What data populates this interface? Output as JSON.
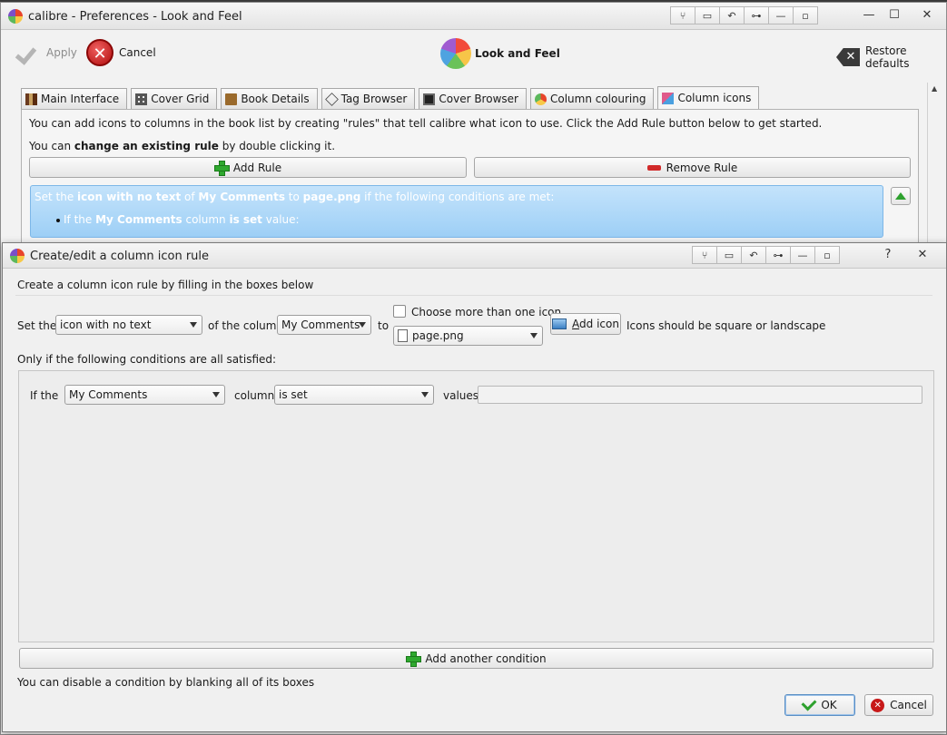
{
  "main_window": {
    "title": "calibre - Preferences - Look and Feel",
    "titlebar_buttons": [
      "⑂",
      "▭",
      "↶",
      "⊶",
      "—",
      "▫"
    ],
    "window_buttons": [
      "—",
      "☐",
      "✕"
    ],
    "toolbar": {
      "apply_label": "Apply",
      "cancel_label": "Cancel",
      "section_title": "Look and Feel",
      "restore_label": "Restore defaults"
    },
    "tabs": [
      {
        "label": "Main Interface",
        "icon": "books-icon"
      },
      {
        "label": "Cover Grid",
        "icon": "grid-icon"
      },
      {
        "label": "Book Details",
        "icon": "book-icon"
      },
      {
        "label": "Tag Browser",
        "icon": "tag-icon"
      },
      {
        "label": "Cover Browser",
        "icon": "cover-icon"
      },
      {
        "label": "Column colouring",
        "icon": "palette-icon"
      },
      {
        "label": "Column icons",
        "icon": "column-icons-icon"
      }
    ],
    "panel": {
      "intro": "You can add icons to columns in the book list by creating \"rules\" that tell calibre what icon to use. Click the Add Rule button below to get started.",
      "change_prefix": "You can ",
      "change_bold": "change an existing rule",
      "change_suffix": " by double clicking it.",
      "add_rule": "Add Rule",
      "remove_rule": "Remove Rule",
      "rule": {
        "line1": [
          "Set the ",
          "icon with no text",
          " of ",
          "My Comments",
          " to ",
          "page.png",
          " if the following conditions are met:"
        ],
        "line2": [
          "If the ",
          "My Comments",
          " column ",
          "is set",
          " value:"
        ]
      }
    }
  },
  "dialog": {
    "title": "Create/edit a column icon rule",
    "titlebar_buttons": [
      "⑂",
      "▭",
      "↶",
      "⊶",
      "—",
      "▫"
    ],
    "window_buttons": [
      "?",
      "✕"
    ],
    "intro": "Create a column icon rule by filling in the boxes below",
    "set_the_label": "Set the",
    "kind_value": "icon with no text",
    "of_column_label": "of the column:",
    "column_value": "My Comments",
    "to_label": "to",
    "multiple_icons_label": "Choose more than one icon",
    "icon_value": "page.png",
    "add_icon_label": "Add icon",
    "add_icon_mnemonic": "A",
    "icon_hint": "Icons should be square or landscape",
    "conditions_label": "Only if the following conditions are all satisfied:",
    "condition": {
      "if_the": "If the",
      "column_value": "My Comments",
      "column_label": "column",
      "action_value": "is set",
      "values_label": "values",
      "values_value": ""
    },
    "add_condition_label": "Add another condition",
    "disable_hint": "You can disable a condition by blanking all of its boxes",
    "ok_label": "OK",
    "cancel_label": "Cancel"
  }
}
